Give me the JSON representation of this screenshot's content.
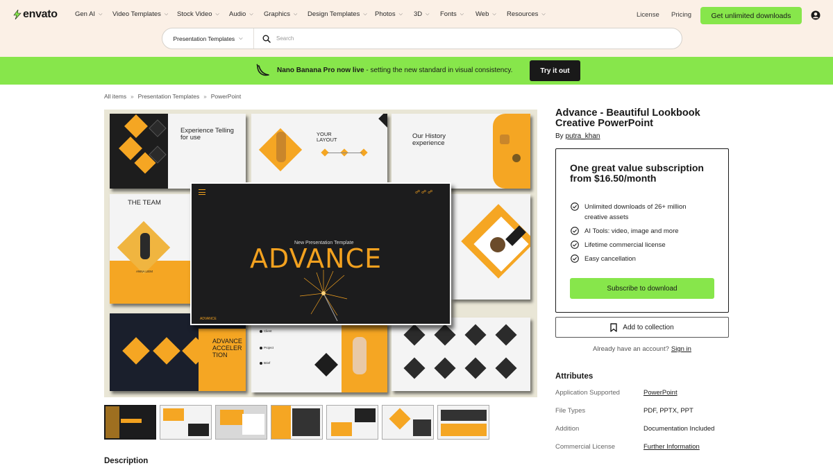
{
  "brand": {
    "name": "envato",
    "accent": "#87e64b",
    "header_bg": "#fbf0e6"
  },
  "nav": {
    "items": [
      {
        "label": "Gen AI"
      },
      {
        "label": "Video Templates"
      },
      {
        "label": "Stock Video"
      },
      {
        "label": "Audio"
      },
      {
        "label": "Graphics"
      },
      {
        "label": "Design Templates"
      },
      {
        "label": "Photos"
      },
      {
        "label": "3D"
      },
      {
        "label": "Fonts"
      },
      {
        "label": "Web"
      },
      {
        "label": "Resources"
      }
    ],
    "license": "License",
    "pricing": "Pricing",
    "cta": "Get unlimited downloads"
  },
  "search": {
    "category": "Presentation Templates",
    "placeholder": "Search"
  },
  "banner": {
    "bold": "Nano Banana Pro now live",
    "rest": " - setting the new standard in visual consistency.",
    "button": "Try it out"
  },
  "breadcrumb": [
    "All items",
    "Presentation Templates",
    "PowerPoint"
  ],
  "preview": {
    "slides": {
      "experience": "Experience Telling for use",
      "layout": "YOUR LAYOUT",
      "history": "Our History experience",
      "team": "THE TEAM",
      "name": "ANNA LIEM",
      "main_sub": "New Presentation Template",
      "main_title": "ADVANCE",
      "main_label": "ADVANCE",
      "accel": "ADVANCE ACCELER TION",
      "client": "Client",
      "project": "Project",
      "brief": "Brief"
    }
  },
  "description_heading": "Description",
  "product": {
    "title": "Advance - Beautiful Lookbook Creative PowerPoint",
    "by": "By",
    "author": "putra_khan"
  },
  "subscription": {
    "heading": "One great value subscription from $16.50/month",
    "features": [
      "Unlimited downloads of 26+ million creative assets",
      "AI Tools: video, image and more",
      "Lifetime commercial license",
      "Easy cancellation"
    ],
    "button": "Subscribe to download"
  },
  "collection_button": "Add to collection",
  "account": {
    "prompt": "Already have an account?",
    "link": "Sign in"
  },
  "attributes": {
    "heading": "Attributes",
    "rows": [
      {
        "label": "Application Supported",
        "value": "PowerPoint"
      },
      {
        "label": "File Types",
        "value": "PDF, PPTX, PPT"
      },
      {
        "label": "Addition",
        "value": "Documentation Included"
      },
      {
        "label": "Commercial License",
        "value": "Further Information"
      }
    ]
  }
}
